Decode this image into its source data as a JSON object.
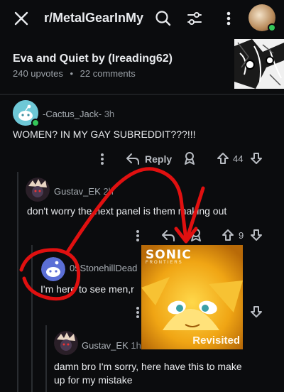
{
  "topbar": {
    "subreddit": "r/MetalGearInMy...",
    "icons": [
      "close-icon",
      "search-icon",
      "filter-icon",
      "more-icon"
    ]
  },
  "post": {
    "title": "Eva and Quiet by (Ireading62)",
    "upvotes": "240 upvotes",
    "separator": "•",
    "comments": "22 comments"
  },
  "comments": [
    {
      "user": "-Cactus_Jack-",
      "time": "3h",
      "text": "WOMEN? IN MY GAY SUBREDDIT???!!!",
      "reply_label": "Reply",
      "votes": "44"
    },
    {
      "user": "Gustav_EK",
      "time": "2h",
      "text": "don't worry the next panel is them making out",
      "votes": "9"
    },
    {
      "user": "05StonehillDead",
      "text": "I'm here to see men,r"
    },
    {
      "user": "Gustav_EK",
      "time": "1h",
      "text_line1": "damn bro I'm sorry, here have this to make",
      "text_line2": "up for my mistake"
    }
  ],
  "sonic_image": {
    "title": "SONIC",
    "subtitle": "FRONTIERS",
    "bottom_text": "Revisited"
  },
  "colors": {
    "background": "#0b0c0e",
    "accent_red": "#e01010",
    "online_green": "#34c759"
  }
}
